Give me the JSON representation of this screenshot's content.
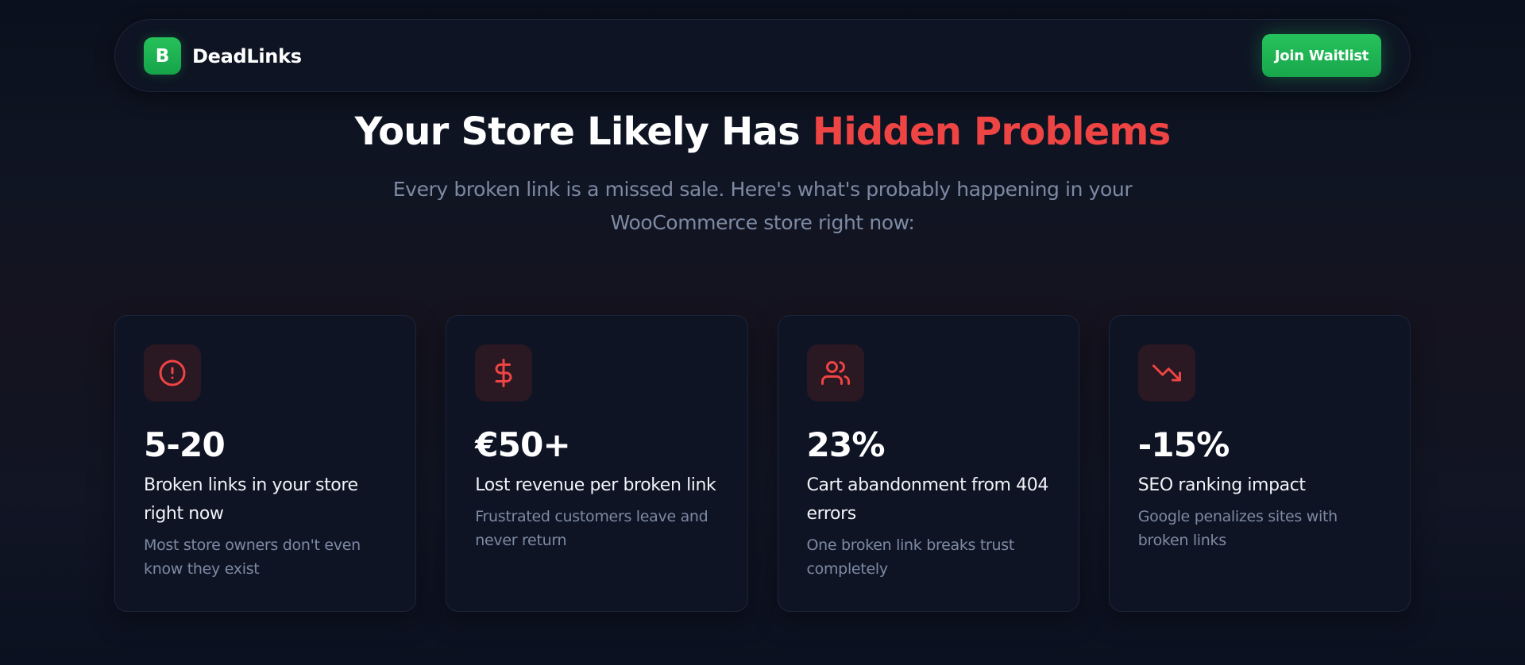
{
  "nav": {
    "logo_letter": "B",
    "brand_name": "DeadLinks",
    "cta_label": "Join Waitlist"
  },
  "hero": {
    "title_prefix": "Your Store Likely Has ",
    "title_accent": "Hidden Problems",
    "subtitle_line1": "Every broken link is a missed sale. Here's what's probably happening in your",
    "subtitle_line2": "WooCommerce store right now:"
  },
  "stats": [
    {
      "icon": "alert-circle-icon",
      "value": "5-20",
      "label": "Broken links in your store right now",
      "description": "Most store owners don't even know they exist"
    },
    {
      "icon": "dollar-icon",
      "value": "€50+",
      "label": "Lost revenue per broken link",
      "description": "Frustrated customers leave and never return"
    },
    {
      "icon": "users-icon",
      "value": "23%",
      "label": "Cart abandonment from 404 errors",
      "description": "One broken link breaks trust completely"
    },
    {
      "icon": "trending-down-icon",
      "value": "-15%",
      "label": "SEO ranking impact",
      "description": "Google penalizes sites with broken links"
    }
  ],
  "colors": {
    "accent_red": "#ef4444",
    "brand_green": "#22c55e",
    "muted_text": "#7d8aa3"
  }
}
